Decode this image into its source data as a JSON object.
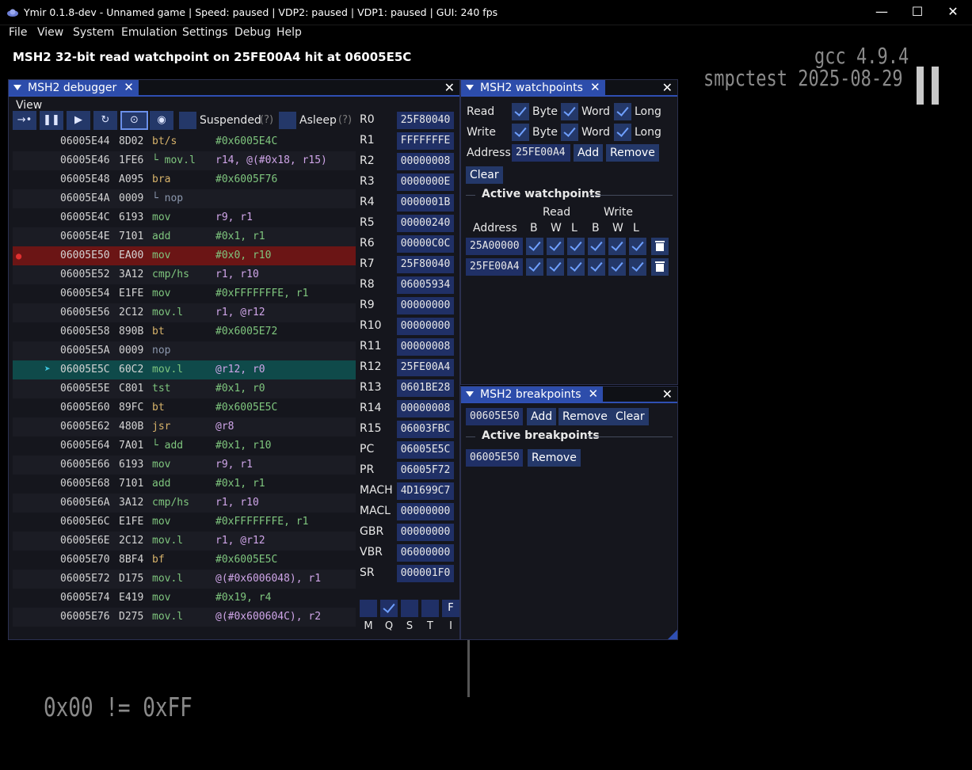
{
  "window": {
    "title": "Ymir 0.1.8-dev - Unnamed game | Speed: paused | VDP2: paused | VDP1: paused | GUI: 240 fps",
    "minimize": "—",
    "maximize": "☐",
    "close": "✕"
  },
  "menu": [
    "File",
    "View",
    "System",
    "Emulation",
    "Settings",
    "Debug",
    "Help"
  ],
  "message": "MSH2 32-bit read watchpoint on 25FE00A4 hit at 06005E5C",
  "screen": {
    "line1": "gcc 4.9.4",
    "line2": "smpctest 2025-08-29",
    "line3": "0x00 != 0xFF"
  },
  "debugger": {
    "tab_label": "MSH2 debugger",
    "view_menu": "View",
    "toolbar": {
      "step": "→•",
      "pause": "❚❚",
      "run": "▶",
      "reset": "↻",
      "follow": "⊙",
      "watch": "◉"
    },
    "suspended_label": "Suspended",
    "suspended_help": "(?)",
    "asleep_label": "Asleep",
    "asleep_help": "(?)",
    "disassembly": [
      {
        "addr": "06005E44",
        "op": "8D02",
        "mn": "bt/s",
        "args": "#0x6005E4C"
      },
      {
        "addr": "06005E46",
        "op": "1FE6",
        "mn": "└ mov.l",
        "args": "r14, @(#0x18, r15)"
      },
      {
        "addr": "06005E48",
        "op": "A095",
        "mn": "bra",
        "args": "#0x6005F76"
      },
      {
        "addr": "06005E4A",
        "op": "0009",
        "mn": "└ nop",
        "args": ""
      },
      {
        "addr": "06005E4C",
        "op": "6193",
        "mn": "mov",
        "args": "r9, r1"
      },
      {
        "addr": "06005E4E",
        "op": "7101",
        "mn": "add",
        "args": "#0x1, r1"
      },
      {
        "addr": "06005E50",
        "op": "EA00",
        "mn": "mov",
        "args": "#0x0, r10"
      },
      {
        "addr": "06005E52",
        "op": "3A12",
        "mn": "cmp/hs",
        "args": "r1, r10"
      },
      {
        "addr": "06005E54",
        "op": "E1FE",
        "mn": "mov",
        "args": "#0xFFFFFFFE, r1"
      },
      {
        "addr": "06005E56",
        "op": "2C12",
        "mn": "mov.l",
        "args": "r1, @r12"
      },
      {
        "addr": "06005E58",
        "op": "890B",
        "mn": "bt",
        "args": "#0x6005E72"
      },
      {
        "addr": "06005E5A",
        "op": "0009",
        "mn": "nop",
        "args": ""
      },
      {
        "addr": "06005E5C",
        "op": "60C2",
        "mn": "mov.l",
        "args": "@r12, r0"
      },
      {
        "addr": "06005E5E",
        "op": "C801",
        "mn": "tst",
        "args": "#0x1, r0"
      },
      {
        "addr": "06005E60",
        "op": "89FC",
        "mn": "bt",
        "args": "#0x6005E5C"
      },
      {
        "addr": "06005E62",
        "op": "480B",
        "mn": "jsr",
        "args": "@r8"
      },
      {
        "addr": "06005E64",
        "op": "7A01",
        "mn": "└ add",
        "args": "#0x1, r10"
      },
      {
        "addr": "06005E66",
        "op": "6193",
        "mn": "mov",
        "args": "r9, r1"
      },
      {
        "addr": "06005E68",
        "op": "7101",
        "mn": "add",
        "args": "#0x1, r1"
      },
      {
        "addr": "06005E6A",
        "op": "3A12",
        "mn": "cmp/hs",
        "args": "r1, r10"
      },
      {
        "addr": "06005E6C",
        "op": "E1FE",
        "mn": "mov",
        "args": "#0xFFFFFFFE, r1"
      },
      {
        "addr": "06005E6E",
        "op": "2C12",
        "mn": "mov.l",
        "args": "r1, @r12"
      },
      {
        "addr": "06005E70",
        "op": "8BF4",
        "mn": "bf",
        "args": "#0x6005E5C"
      },
      {
        "addr": "06005E72",
        "op": "D175",
        "mn": "mov.l",
        "args": "@(#0x6006048), r1"
      },
      {
        "addr": "06005E74",
        "op": "E419",
        "mn": "mov",
        "args": "#0x19, r4"
      },
      {
        "addr": "06005E76",
        "op": "D275",
        "mn": "mov.l",
        "args": "@(#0x600604C), r2"
      }
    ],
    "breakpoint_marker": "●",
    "pc_marker": "➤",
    "registers": [
      {
        "name": "R0",
        "value": "25F80040"
      },
      {
        "name": "R1",
        "value": "FFFFFFFE"
      },
      {
        "name": "R2",
        "value": "00000008"
      },
      {
        "name": "R3",
        "value": "0000000E"
      },
      {
        "name": "R4",
        "value": "0000001B"
      },
      {
        "name": "R5",
        "value": "00000240"
      },
      {
        "name": "R6",
        "value": "00000C0C"
      },
      {
        "name": "R7",
        "value": "25F80040"
      },
      {
        "name": "R8",
        "value": "06005934"
      },
      {
        "name": "R9",
        "value": "00000000"
      },
      {
        "name": "R10",
        "value": "00000000"
      },
      {
        "name": "R11",
        "value": "00000008"
      },
      {
        "name": "R12",
        "value": "25FE00A4"
      },
      {
        "name": "R13",
        "value": "0601BE28"
      },
      {
        "name": "R14",
        "value": "00000008"
      },
      {
        "name": "R15",
        "value": "06003FBC"
      },
      {
        "name": "PC",
        "value": "06005E5C"
      },
      {
        "name": "PR",
        "value": "06005F72"
      },
      {
        "name": "MACH",
        "value": "4D1699C7"
      },
      {
        "name": "MACL",
        "value": "00000000"
      },
      {
        "name": "GBR",
        "value": "00000000"
      },
      {
        "name": "VBR",
        "value": "06000000"
      },
      {
        "name": "SR",
        "value": "000001F0"
      }
    ],
    "flags": [
      {
        "name": "M",
        "checked": false,
        "value": ""
      },
      {
        "name": "Q",
        "checked": true,
        "value": ""
      },
      {
        "name": "S",
        "checked": false,
        "value": ""
      },
      {
        "name": "T",
        "checked": false,
        "value": ""
      },
      {
        "name": "I",
        "checked": false,
        "value": "F"
      }
    ]
  },
  "watchpoints": {
    "tab_label": "MSH2 watchpoints",
    "read_label": "Read",
    "write_label": "Write",
    "byte_label": "Byte",
    "word_label": "Word",
    "long_label": "Long",
    "address_label": "Address",
    "address_value": "25FE00A4",
    "add_button": "Add",
    "remove_button": "Remove",
    "clear_button": "Clear",
    "active_title": "Active watchpoints",
    "col_read": "Read",
    "col_write": "Write",
    "col_address": "Address",
    "cols": [
      "B",
      "W",
      "L",
      "B",
      "W",
      "L"
    ],
    "entries": [
      "25A00000",
      "25FE00A4"
    ]
  },
  "breakpoints": {
    "tab_label": "MSH2 breakpoints",
    "address_value": "00605E50",
    "add_button": "Add",
    "remove_button": "Remove",
    "clear_button": "Clear",
    "active_title": "Active breakpoints",
    "entries": [
      {
        "address": "06005E50",
        "remove": "Remove"
      }
    ]
  }
}
